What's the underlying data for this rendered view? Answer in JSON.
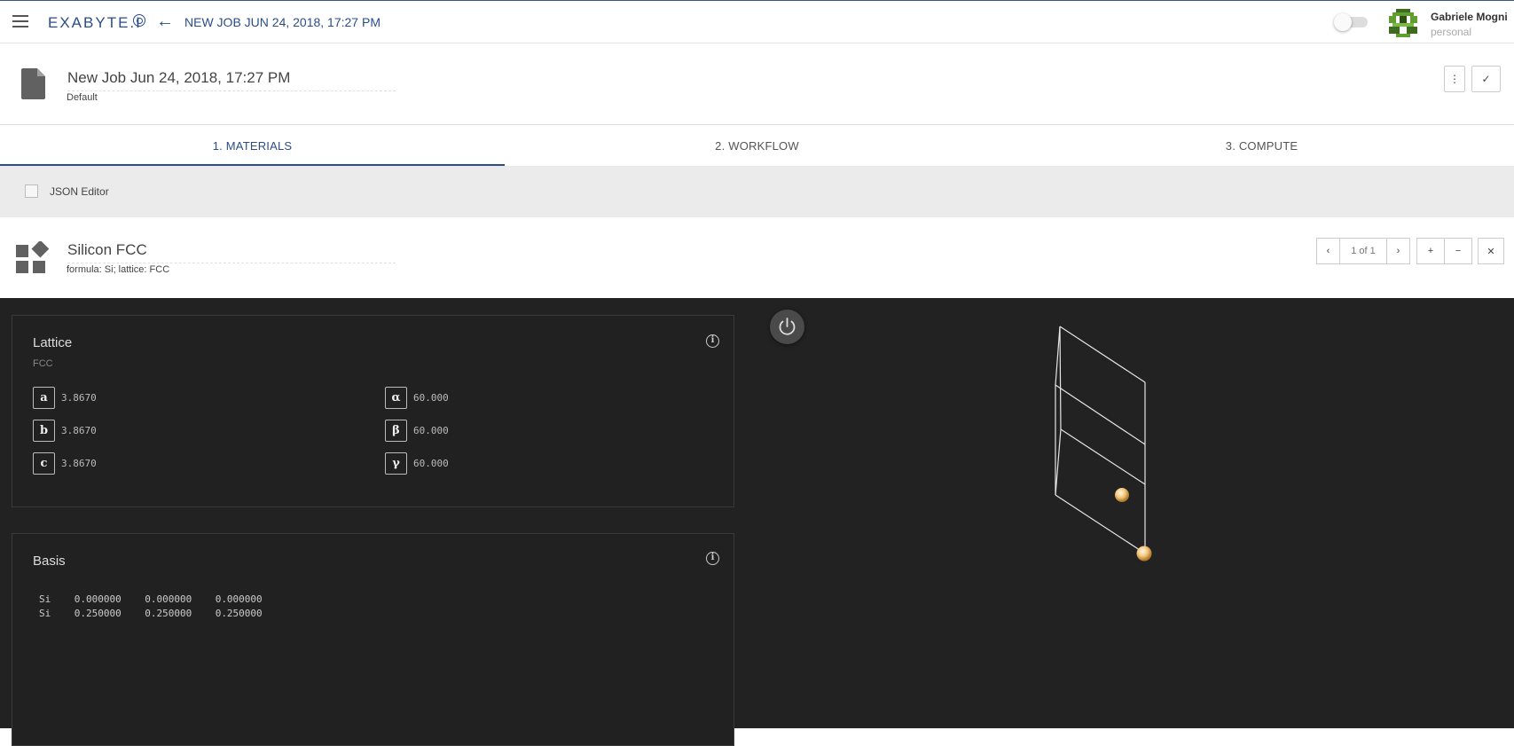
{
  "app": {
    "logo_text": "EXABYTE.I",
    "header_title": "NEW JOB JUN 24, 2018, 17:27 PM",
    "user": {
      "name": "Gabriele Mogni",
      "account": "personal"
    }
  },
  "job": {
    "name": "New Job Jun 24, 2018, 17:27 PM",
    "project": "Default",
    "actions": {
      "more": "⋮",
      "confirm": "✓"
    }
  },
  "tabs": [
    {
      "label": "1. MATERIALS",
      "active": true
    },
    {
      "label": "2. WORKFLOW",
      "active": false
    },
    {
      "label": "3. COMPUTE",
      "active": false
    }
  ],
  "json_editor": {
    "label": "JSON Editor",
    "checked": false
  },
  "material": {
    "name": "Silicon FCC",
    "description": "formula: Si; lattice: FCC",
    "pager": {
      "prev": "‹",
      "text": "1 of 1",
      "next": "›",
      "add": "+",
      "remove": "−",
      "close": "✕"
    }
  },
  "lattice": {
    "title": "Lattice",
    "type": "FCC",
    "params": [
      {
        "label": "a",
        "value": "3.8670"
      },
      {
        "label": "α",
        "value": "60.000"
      },
      {
        "label": "b",
        "value": "3.8670"
      },
      {
        "label": "β",
        "value": "60.000"
      },
      {
        "label": "c",
        "value": "3.8670"
      },
      {
        "label": "γ",
        "value": "60.000"
      }
    ]
  },
  "basis": {
    "title": "Basis",
    "atoms": [
      {
        "element": "Si",
        "coords": "0.000000    0.000000    0.000000"
      },
      {
        "element": "Si",
        "coords": "0.250000    0.250000    0.250000"
      }
    ]
  },
  "icons": {
    "menu": "hamburger-icon",
    "back": "arrow-left-icon",
    "info": "info-icon",
    "power": "power-icon",
    "document": "document-icon",
    "material": "material-icon"
  },
  "colors": {
    "brand": "#2b4d8a",
    "dark_bg": "#222222",
    "atom": "#f5c77e"
  }
}
